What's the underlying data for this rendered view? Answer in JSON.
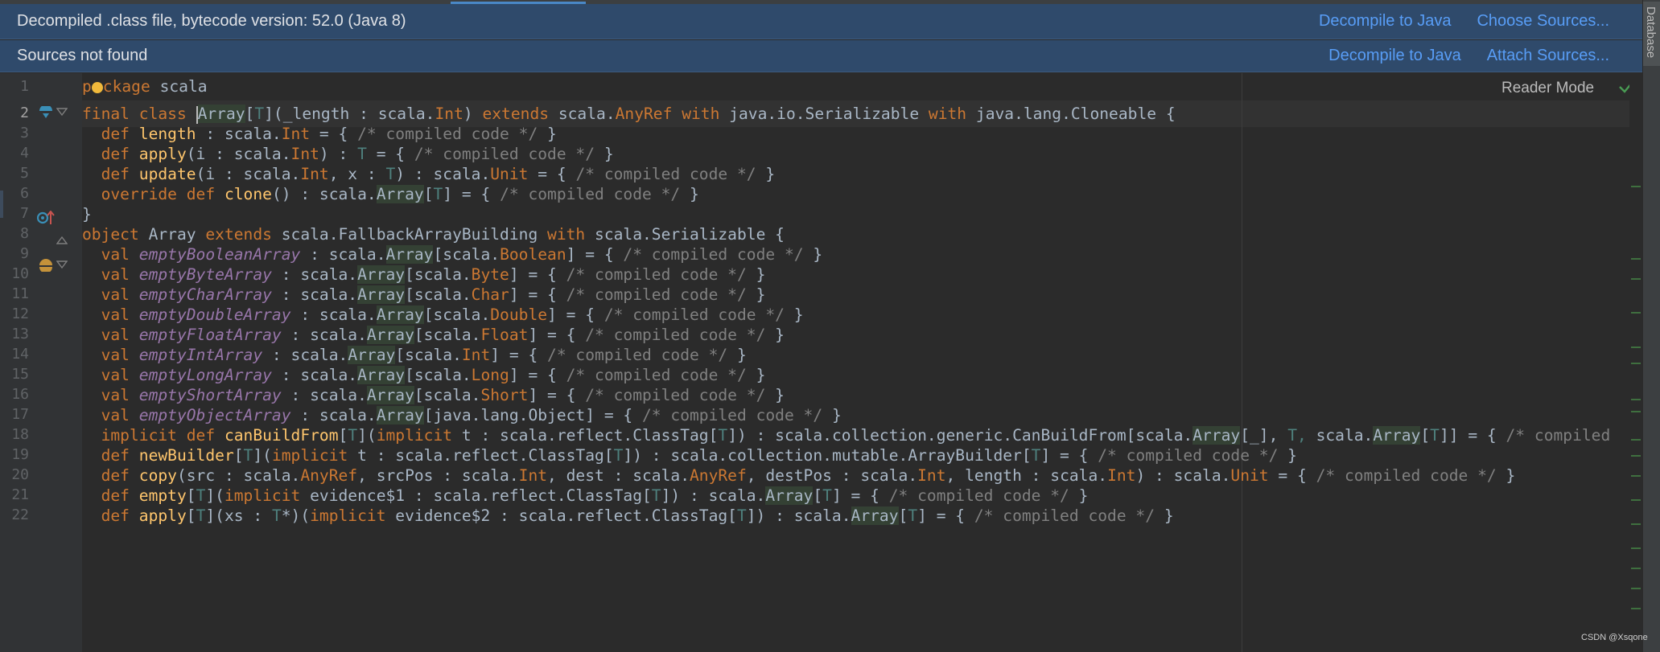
{
  "banners": {
    "decompiled": {
      "message": "Decompiled .class file, bytecode version: 52.0 (Java 8)",
      "decompile_link": "Decompile to Java",
      "choose_link": "Choose Sources..."
    },
    "sources": {
      "message": "Sources not found",
      "decompile_link": "Decompile to Java",
      "attach_link": "Attach Sources..."
    }
  },
  "side_tab": {
    "label": "Database"
  },
  "editor": {
    "reader_mode": "Reader Mode",
    "current_line": 2
  },
  "line_numbers": [
    "1",
    "2",
    "3",
    "4",
    "5",
    "6",
    "7",
    "8",
    "9",
    "10",
    "11",
    "12",
    "13",
    "14",
    "15",
    "16",
    "17",
    "18",
    "19",
    "20",
    "21",
    "22"
  ],
  "code": {
    "l1": {
      "kw": "ckage",
      "name": " scala",
      "p": "p"
    },
    "l2": {
      "final": "final",
      "class": " class ",
      "t1": "Array",
      "t2": "[",
      "t3": "T",
      "t4": "](_length : scala.",
      "t5": "Int",
      "t6": ") ",
      "ext": "extends",
      "t7": " scala.",
      "t8": "AnyRef",
      "with1": " with",
      "t9": " java.io.Serializable ",
      "with2": "with",
      "t10": " java.lang.Cloneable {"
    },
    "l3": {
      "def": "def ",
      "fn": "length",
      "a": " : scala.",
      "b": "Int",
      "c": " = { ",
      "cm": "/* compiled code */",
      "d": " }"
    },
    "l4": {
      "def": "def ",
      "fn": "apply",
      "a": "(i : scala.",
      "b": "Int",
      "c": ") : ",
      "d": "T",
      "e": " = { ",
      "cm": "/* compiled code */",
      "f": " }"
    },
    "l5": {
      "def": "def ",
      "fn": "update",
      "a": "(i : scala.",
      "b": "Int",
      "c": ", x : ",
      "d": "T",
      "e": ") : scala.",
      "g": "Unit",
      "h": " = { ",
      "cm": "/* compiled code */",
      "f": " }"
    },
    "l6": {
      "ov": "override ",
      "def": "def ",
      "fn": "clone",
      "a": "() : scala.",
      "b": "Array",
      "c": "[",
      "d": "T",
      "e": "] = { ",
      "cm": "/* compiled code */",
      "f": " }"
    },
    "l7": {
      "a": "}"
    },
    "l8": {
      "obj": "object",
      "a": " Array ",
      "ext": "extends",
      "b": " scala.FallbackArrayBuilding ",
      "with": "with",
      "c": " scala.Serializable {"
    },
    "vals": [
      {
        "val": "val ",
        "name": "emptyBooleanArray",
        "a": " : scala.",
        "arr": "Array",
        "b": "[scala.",
        "t": "Boolean",
        "c": "] = { ",
        "cm": "/* compiled code */",
        "d": " }"
      },
      {
        "val": "val ",
        "name": "emptyByteArray",
        "a": " : scala.",
        "arr": "Array",
        "b": "[scala.",
        "t": "Byte",
        "c": "] = { ",
        "cm": "/* compiled code */",
        "d": " }"
      },
      {
        "val": "val ",
        "name": "emptyCharArray",
        "a": " : scala.",
        "arr": "Array",
        "b": "[scala.",
        "t": "Char",
        "c": "] = { ",
        "cm": "/* compiled code */",
        "d": " }"
      },
      {
        "val": "val ",
        "name": "emptyDoubleArray",
        "a": " : scala.",
        "arr": "Array",
        "b": "[scala.",
        "t": "Double",
        "c": "] = { ",
        "cm": "/* compiled code */",
        "d": " }"
      },
      {
        "val": "val ",
        "name": "emptyFloatArray",
        "a": " : scala.",
        "arr": "Array",
        "b": "[scala.",
        "t": "Float",
        "c": "] = { ",
        "cm": "/* compiled code */",
        "d": " }"
      },
      {
        "val": "val ",
        "name": "emptyIntArray",
        "a": " : scala.",
        "arr": "Array",
        "b": "[scala.",
        "t": "Int",
        "c": "] = { ",
        "cm": "/* compiled code */",
        "d": " }"
      },
      {
        "val": "val ",
        "name": "emptyLongArray",
        "a": " : scala.",
        "arr": "Array",
        "b": "[scala.",
        "t": "Long",
        "c": "] = { ",
        "cm": "/* compiled code */",
        "d": " }"
      },
      {
        "val": "val ",
        "name": "emptyShortArray",
        "a": " : scala.",
        "arr": "Array",
        "b": "[scala.",
        "t": "Short",
        "c": "] = { ",
        "cm": "/* compiled code */",
        "d": " }"
      }
    ],
    "l17": {
      "val": "val ",
      "name": "emptyObjectArray",
      "a": " : scala.",
      "arr": "Array",
      "b": "[java.lang.Object] = { ",
      "cm": "/* compiled code */",
      "d": " }"
    },
    "l18": {
      "imp": "implicit ",
      "def": "def ",
      "fn": "canBuildFrom",
      "a": "[",
      "t": "T",
      "b": "](",
      "imp2": "implicit",
      "c": " t : scala.reflect.ClassTag[",
      "t2": "T",
      "d": "]) : scala.collection.generic.CanBuildFrom[scala.",
      "arr": "Array",
      "e": "[_], ",
      "t3": "T, ",
      "f": "scala.",
      "arr2": "Array",
      "g": "[",
      "t4": "T",
      "h": "]] = { ",
      "cm": "/* compiled"
    },
    "l19": {
      "def": "def ",
      "fn": "newBuilder",
      "a": "[",
      "t": "T",
      "b": "](",
      "imp": "implicit",
      "c": " t : scala.reflect.ClassTag[",
      "t2": "T",
      "d": "]) : scala.collection.mutable.ArrayBuilder[",
      "t3": "T",
      "e": "] = { ",
      "cm": "/* compiled code */",
      "f": " }"
    },
    "l20": {
      "def": "def ",
      "fn": "copy",
      "a": "(src : scala.",
      "b": "AnyRef",
      "c": ", srcPos : scala.",
      "d": "Int",
      "e": ", dest : scala.",
      "f": "AnyRef",
      "g": ", destPos : scala.",
      "h": "Int",
      "i": ", length : scala.",
      "j": "Int",
      "k": ") : scala.",
      "l": "Unit",
      "m": " = { ",
      "cm": "/* compiled code */",
      "n": " }"
    },
    "l21": {
      "def": "def ",
      "fn": "empty",
      "a": "[",
      "t": "T",
      "b": "](",
      "imp": "implicit",
      "c": " evidence$1 : scala.reflect.ClassTag[",
      "t2": "T",
      "d": "]) : scala.",
      "arr": "Array",
      "e": "[",
      "t3": "T",
      "f": "] = { ",
      "cm": "/* compiled code */",
      "g": " }"
    },
    "l22": {
      "def": "def ",
      "fn": "apply",
      "a": "[",
      "t": "T",
      "b": "](xs : ",
      "t2": "T",
      "c": "*)(",
      "imp": "implicit",
      "d": " evidence$2 : scala.reflect.ClassTag[",
      "t3": "T",
      "e": "]) : scala.",
      "arr": "Array",
      "f": "[",
      "t4": "T",
      "g": "] = { ",
      "cm": "/* compiled code */",
      "h": " }"
    }
  },
  "watermark": "CSDN @Xsqone",
  "colors": {
    "keyword": "#cc7832",
    "type": "#4e807d",
    "italic_field": "#9876aa",
    "function": "#ffc66d",
    "comment": "#808080",
    "banner_bg": "#2f4a6b",
    "link": "#589df6"
  }
}
